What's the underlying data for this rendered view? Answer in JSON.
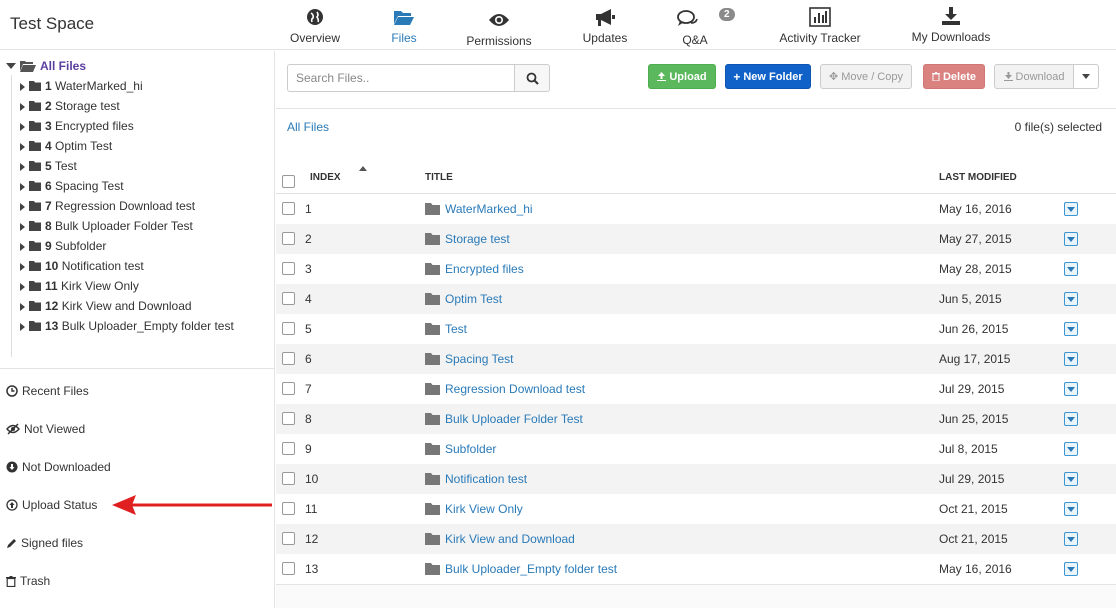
{
  "header": {
    "space_title": "Test Space",
    "tabs": [
      {
        "label": "Overview",
        "icon": "globe-icon"
      },
      {
        "label": "Files",
        "icon": "folder-open-icon"
      },
      {
        "label": "Permissions",
        "icon": "eye-icon"
      },
      {
        "label": "Updates",
        "icon": "megaphone-icon"
      },
      {
        "label": "Q&A",
        "icon": "comments-icon",
        "badge": "2"
      },
      {
        "label": "Activity Tracker",
        "icon": "bar-chart-icon"
      },
      {
        "label": "My Downloads",
        "icon": "download-icon"
      }
    ],
    "active_tab": "Files"
  },
  "sidebar": {
    "tree_root": "All Files",
    "tree": [
      {
        "num": "1",
        "name": "WaterMarked_hi"
      },
      {
        "num": "2",
        "name": "Storage test"
      },
      {
        "num": "3",
        "name": "Encrypted files"
      },
      {
        "num": "4",
        "name": "Optim Test"
      },
      {
        "num": "5",
        "name": "Test"
      },
      {
        "num": "6",
        "name": "Spacing Test"
      },
      {
        "num": "7",
        "name": "Regression Download test"
      },
      {
        "num": "8",
        "name": "Bulk Uploader Folder Test"
      },
      {
        "num": "9",
        "name": "Subfolder"
      },
      {
        "num": "10",
        "name": "Notification test"
      },
      {
        "num": "11",
        "name": "Kirk View Only"
      },
      {
        "num": "12",
        "name": "Kirk View and Download"
      },
      {
        "num": "13",
        "name": "Bulk Uploader_Empty folder test"
      }
    ],
    "links": [
      {
        "label": "Recent Files",
        "icon": "clock-icon"
      },
      {
        "label": "Not Viewed",
        "icon": "eye-slash-icon"
      },
      {
        "label": "Not Downloaded",
        "icon": "download-circle-icon"
      },
      {
        "label": "Upload Status",
        "icon": "upload-circle-icon"
      },
      {
        "label": "Signed files",
        "icon": "pencil-icon"
      },
      {
        "label": "Trash",
        "icon": "trash-icon"
      }
    ]
  },
  "toolbar": {
    "search_placeholder": "Search Files..",
    "upload_label": "Upload",
    "new_folder_label": "New Folder",
    "move_copy_label": "Move / Copy",
    "delete_label": "Delete",
    "download_label": "Download"
  },
  "content": {
    "breadcrumb": "All Files",
    "selected_count": "0 file(s) selected"
  },
  "table": {
    "columns": {
      "index": "INDEX",
      "title": "TITLE",
      "last_modified": "LAST MODIFIED"
    },
    "rows": [
      {
        "index": "1",
        "title": "WaterMarked_hi",
        "modified": "May 16, 2016"
      },
      {
        "index": "2",
        "title": "Storage test",
        "modified": "May 27, 2015"
      },
      {
        "index": "3",
        "title": "Encrypted files",
        "modified": "May 28, 2015"
      },
      {
        "index": "4",
        "title": "Optim Test",
        "modified": "Jun 5, 2015"
      },
      {
        "index": "5",
        "title": "Test",
        "modified": "Jun 26, 2015"
      },
      {
        "index": "6",
        "title": "Spacing Test",
        "modified": "Aug 17, 2015"
      },
      {
        "index": "7",
        "title": "Regression Download test",
        "modified": "Jul 29, 2015"
      },
      {
        "index": "8",
        "title": "Bulk Uploader Folder Test",
        "modified": "Jun 25, 2015"
      },
      {
        "index": "9",
        "title": "Subfolder",
        "modified": "Jul 8, 2015"
      },
      {
        "index": "10",
        "title": "Notification test",
        "modified": "Jul 29, 2015"
      },
      {
        "index": "11",
        "title": "Kirk View Only",
        "modified": "Oct 21, 2015"
      },
      {
        "index": "12",
        "title": "Kirk View and Download",
        "modified": "Oct 21, 2015"
      },
      {
        "index": "13",
        "title": "Bulk Uploader_Empty folder test",
        "modified": "May 16, 2016"
      }
    ]
  },
  "annotation": {
    "arrow_color": "#e02020"
  },
  "colors": {
    "link": "#2a7ab8",
    "upload": "#5cb85c",
    "new_folder": "#1162c8",
    "delete": "#d9827f",
    "tree_root": "#5a3fa0"
  }
}
